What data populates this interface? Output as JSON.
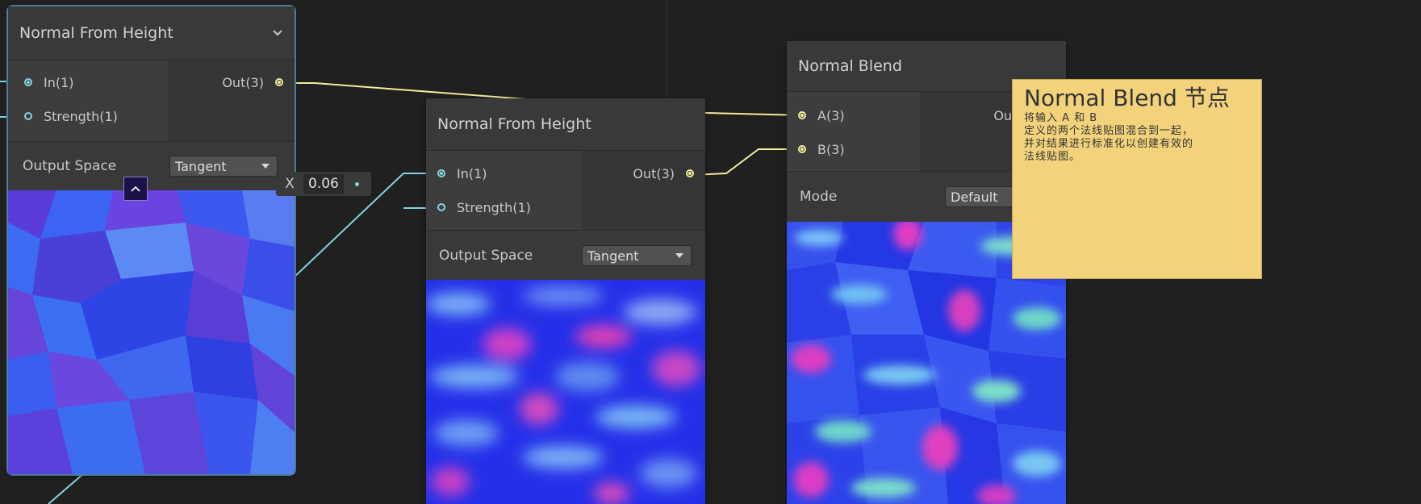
{
  "nodes": {
    "height1": {
      "title": "Normal From Height",
      "inputs": [
        "In(1)",
        "Strength(1)"
      ],
      "output": "Out(3)",
      "setting_label": "Output Space",
      "setting_value": "Tangent"
    },
    "height2": {
      "title": "Normal From Height",
      "inputs": [
        "In(1)",
        "Strength(1)"
      ],
      "output": "Out(3)",
      "setting_label": "Output Space",
      "setting_value": "Tangent"
    },
    "blend": {
      "title": "Normal Blend",
      "inputs": [
        "A(3)",
        "B(3)"
      ],
      "output": "Out(3)",
      "setting_label": "Mode",
      "setting_value": "Default"
    }
  },
  "strength_input": {
    "axis": "X",
    "value": "0.06"
  },
  "sticky_note": {
    "title": "Normal Blend 节点",
    "body": "将输入 A 和 B\n定义的两个法线贴图混合到一起，\n并对结果进行标准化以创建有效的\n法线贴图。"
  },
  "colors": {
    "background": "#202020",
    "node": "#393939",
    "vector1_port": "#84d3e0",
    "vector3_port": "#f0ee9a",
    "selection": "#4a7e93",
    "sticky": "#f2d27b"
  },
  "icons": [
    "chevron-down-icon",
    "collapse-preview-icon",
    "dropdown-caret-icon"
  ]
}
